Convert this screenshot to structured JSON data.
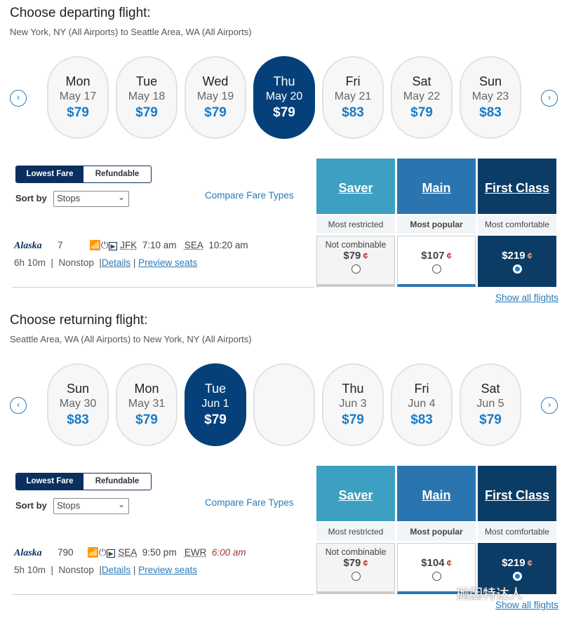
{
  "colors": {
    "accent": "#1a7bc6",
    "selected": "#05407a",
    "saver": "#3d9fc2",
    "main": "#2a75b0",
    "first": "#0b3c66"
  },
  "sections": [
    {
      "title": "Choose departing flight:",
      "subtitle": "New York, NY (All Airports) to Seattle Area, WA (All Airports)",
      "dates": [
        {
          "day": "Mon",
          "date": "May 17",
          "price": "$79"
        },
        {
          "day": "Tue",
          "date": "May 18",
          "price": "$79"
        },
        {
          "day": "Wed",
          "date": "May 19",
          "price": "$79"
        },
        {
          "day": "Thu",
          "date": "May 20",
          "price": "$79",
          "selected": true
        },
        {
          "day": "Fri",
          "date": "May 21",
          "price": "$83"
        },
        {
          "day": "Sat",
          "date": "May 22",
          "price": "$79"
        },
        {
          "day": "Sun",
          "date": "May 23",
          "price": "$83"
        }
      ],
      "toggle": [
        "Lowest Fare",
        "Refundable"
      ],
      "sort_label": "Sort by",
      "sort_value": "Stops",
      "compare": "Compare Fare Types",
      "fares": [
        {
          "name": "Saver",
          "desc": "Most restricted",
          "note": "Not combinable",
          "price": "$79"
        },
        {
          "name": "Main",
          "desc": "Most popular",
          "price": "$107"
        },
        {
          "name": "First Class",
          "desc": "Most comfortable",
          "price": "$219",
          "selected": true
        }
      ],
      "flight": {
        "airline": "Alaska",
        "number": "7",
        "from": "JFK",
        "dep": "7:10 am",
        "to": "SEA",
        "arr": "10:20 am",
        "duration": "6h 10m",
        "stops": "Nonstop",
        "details": "Details",
        "seats": "Preview seats"
      },
      "show_all": "Show all flights"
    },
    {
      "title": "Choose returning flight:",
      "subtitle": "Seattle Area, WA (All Airports) to New York, NY (All Airports)",
      "dates": [
        {
          "day": "Sun",
          "date": "May 30",
          "price": "$83"
        },
        {
          "day": "Mon",
          "date": "May 31",
          "price": "$79"
        },
        {
          "day": "Tue",
          "date": "Jun 1",
          "price": "$79",
          "selected": true
        },
        {
          "day": "Wed",
          "date": "Jun 2",
          "price": "$79",
          "disabled": true
        },
        {
          "day": "Thu",
          "date": "Jun 3",
          "price": "$79"
        },
        {
          "day": "Fri",
          "date": "Jun 4",
          "price": "$83"
        },
        {
          "day": "Sat",
          "date": "Jun 5",
          "price": "$79"
        }
      ],
      "toggle": [
        "Lowest Fare",
        "Refundable"
      ],
      "sort_label": "Sort by",
      "sort_value": "Stops",
      "compare": "Compare Fare Types",
      "fares": [
        {
          "name": "Saver",
          "desc": "Most restricted",
          "note": "Not combinable",
          "price": "$79"
        },
        {
          "name": "Main",
          "desc": "Most popular",
          "price": "$104"
        },
        {
          "name": "First Class",
          "desc": "Most comfortable",
          "price": "$219",
          "selected": true
        }
      ],
      "flight": {
        "airline": "Alaska",
        "number": "790",
        "from": "SEA",
        "dep": "9:50 pm",
        "to": "EWR",
        "arr": "6:00 am",
        "arr_next_day": true,
        "duration": "5h 10m",
        "stops": "Nonstop",
        "details": "Details",
        "seats": "Preview seats"
      },
      "show_all": "Show all flights"
    }
  ],
  "watermark": "抛因特达人"
}
